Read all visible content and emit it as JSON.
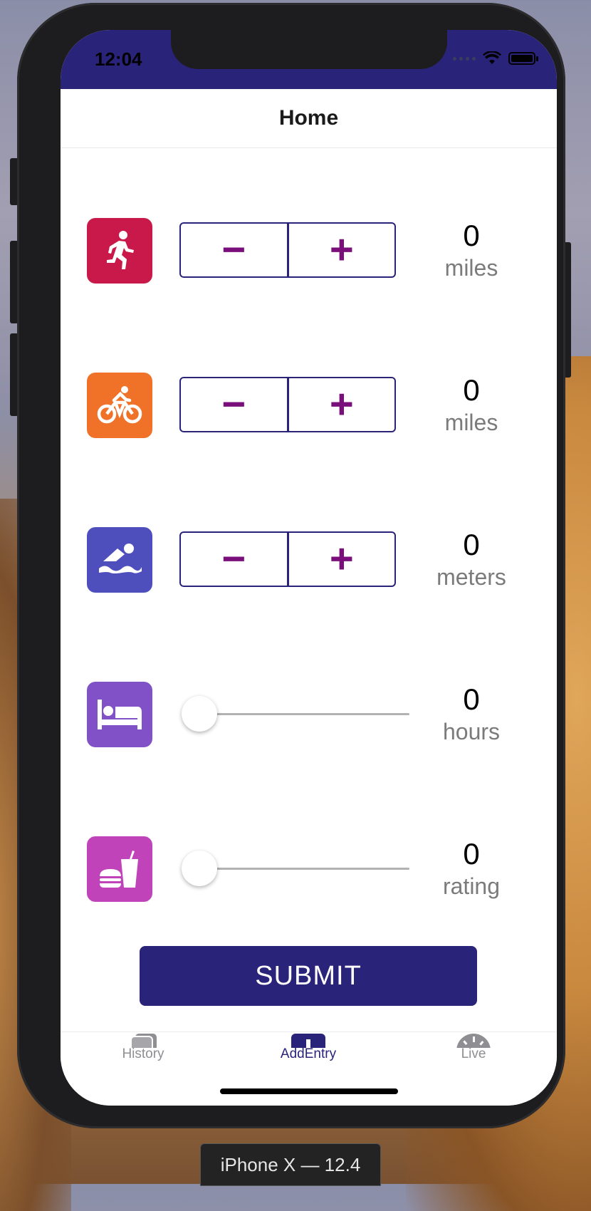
{
  "status_bar": {
    "time": "12:04"
  },
  "header": {
    "title": "Home"
  },
  "entries": [
    {
      "icon": "running-icon",
      "color": "#c8194a",
      "control": "stepper",
      "minus": "−",
      "plus": "+",
      "value": "0",
      "unit": "miles"
    },
    {
      "icon": "bicycle-icon",
      "color": "#f07229",
      "control": "stepper",
      "minus": "−",
      "plus": "+",
      "value": "0",
      "unit": "miles"
    },
    {
      "icon": "swimming-icon",
      "color": "#4e4fbd",
      "control": "stepper",
      "minus": "−",
      "plus": "+",
      "value": "0",
      "unit": "meters"
    },
    {
      "icon": "bed-icon",
      "color": "#8051c7",
      "control": "slider",
      "slider_value": 0,
      "value": "0",
      "unit": "hours"
    },
    {
      "icon": "fastfood-icon",
      "color": "#c043b9",
      "control": "slider",
      "slider_value": 0,
      "value": "0",
      "unit": "rating"
    }
  ],
  "submit": {
    "label": "SUBMIT"
  },
  "tabs": [
    {
      "label": "History",
      "icon": "cards-icon",
      "active": false,
      "color": "#8e8e93"
    },
    {
      "label": "AddEntry",
      "icon": "add-entry-icon",
      "active": true,
      "color": "#2a237a"
    },
    {
      "label": "Live",
      "icon": "speedometer-icon",
      "active": false,
      "color": "#8e8e93"
    }
  ],
  "device": {
    "label": "iPhone X — 12.4"
  }
}
